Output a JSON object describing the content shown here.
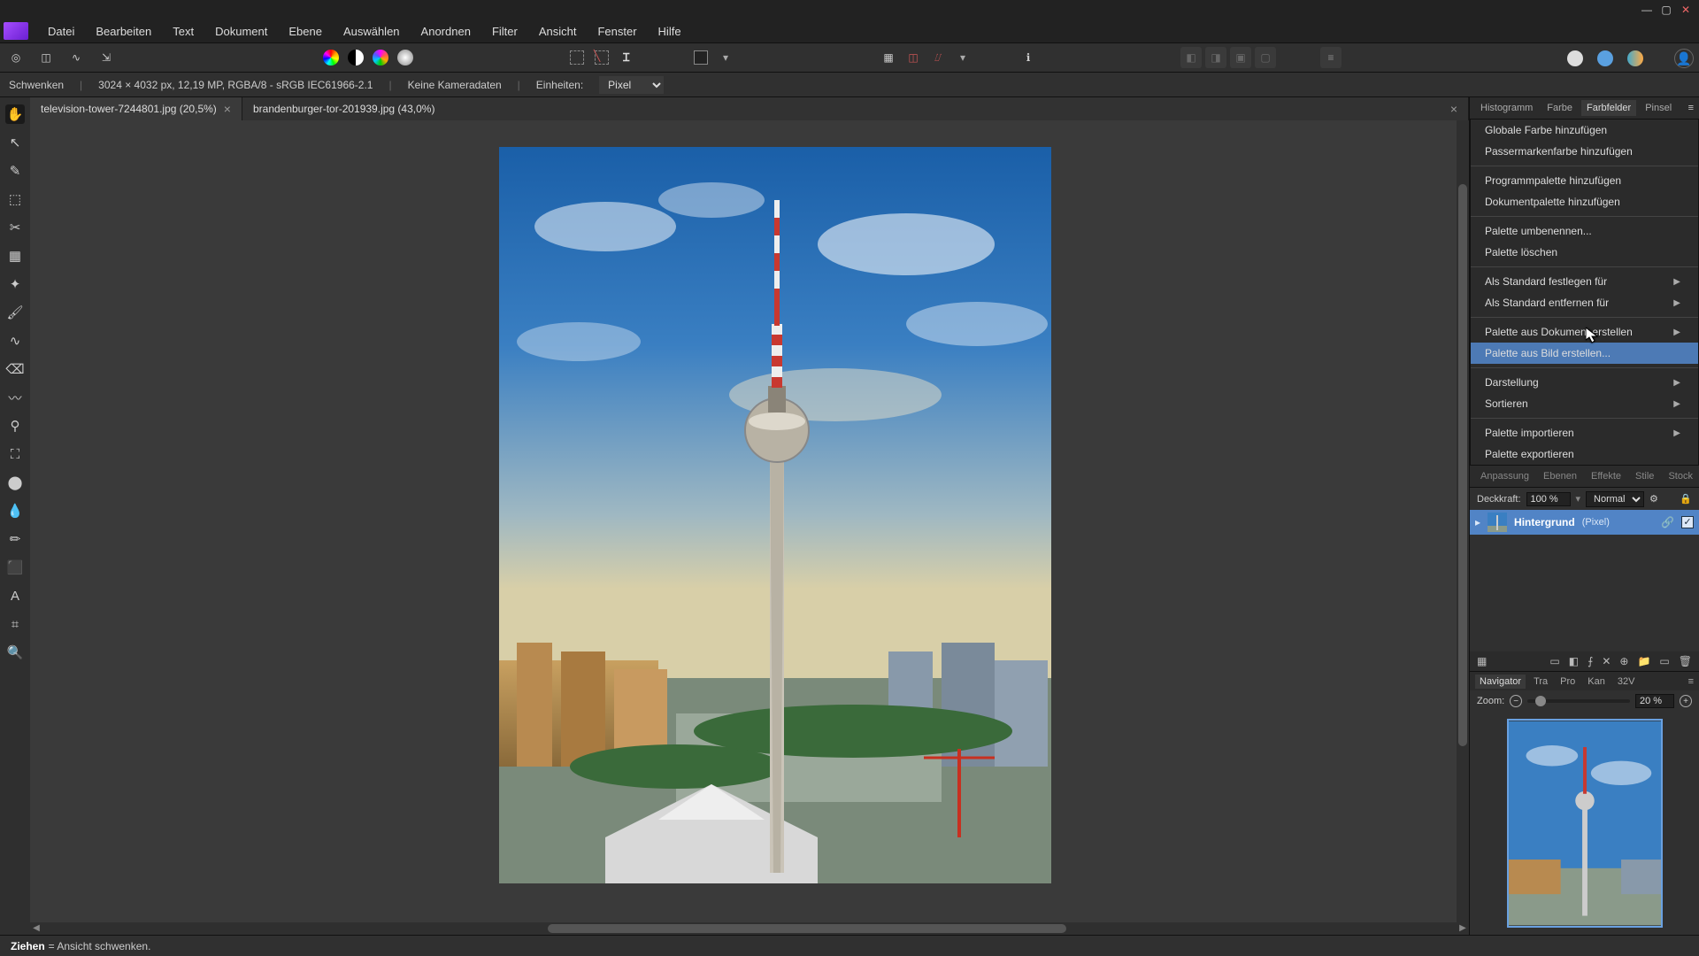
{
  "window": {
    "minimize": "—",
    "maximize": "▢",
    "close": "✕"
  },
  "menubar": [
    "Datei",
    "Bearbeiten",
    "Text",
    "Dokument",
    "Ebene",
    "Auswählen",
    "Anordnen",
    "Filter",
    "Ansicht",
    "Fenster",
    "Hilfe"
  ],
  "contextbar": {
    "tool": "Schwenken",
    "dims": "3024 × 4032 px, 12,19 MP, RGBA/8 - sRGB IEC61966-2.1",
    "camera": "Keine Kameradaten",
    "units_label": "Einheiten:",
    "units_value": "Pixel"
  },
  "tabs": [
    {
      "label": "television-tower-7244801.jpg (20,5%)",
      "active": true
    },
    {
      "label": "brandenburger-tor-201939.jpg (43,0%)",
      "active": false
    }
  ],
  "panel_tabs": {
    "items": [
      "Histogramm",
      "Farbe",
      "Farbfelder",
      "Pinsel"
    ],
    "active": 2
  },
  "context_menu": {
    "groups": [
      [
        "Globale Farbe hinzufügen",
        "Passermarkenfarbe hinzufügen"
      ],
      [
        "Programmpalette hinzufügen",
        "Dokumentpalette hinzufügen"
      ],
      [
        "Palette umbenennen...",
        "Palette löschen"
      ],
      [
        {
          "t": "Als Standard festlegen für",
          "sub": true
        },
        {
          "t": "Als Standard entfernen für",
          "sub": true
        }
      ],
      [
        {
          "t": "Palette aus Dokument erstellen",
          "sub": true
        },
        {
          "t": "Palette aus Bild erstellen...",
          "hover": true
        }
      ],
      [
        {
          "t": "Darstellung",
          "sub": true
        },
        {
          "t": "Sortieren",
          "sub": true
        }
      ],
      [
        {
          "t": "Palette importieren",
          "sub": true
        },
        "Palette exportieren"
      ]
    ]
  },
  "layers_bar_tabs": [
    "Anpassung",
    "Ebenen",
    "Effekte",
    "Stile",
    "Stock"
  ],
  "layers": {
    "opacity_label": "Deckkraft:",
    "opacity_value": "100 %",
    "blend_mode": "Normal",
    "item_name": "Hintergrund",
    "item_type": "(Pixel)"
  },
  "navigator": {
    "tabs": [
      "Navigator",
      "Tra",
      "Pro",
      "Kan",
      "32V"
    ],
    "zoom_label": "Zoom:",
    "zoom_value": "20 %"
  },
  "statusbar": {
    "action": "Ziehen",
    "desc": " = Ansicht schwenken."
  },
  "tool_icons": [
    "✋",
    "↖",
    "✎",
    "⬚",
    "✂",
    "▦",
    "✦",
    "🖌",
    "∿",
    "⌫",
    "〰",
    "⚲",
    "⛶",
    "⬤",
    "💧",
    "✏",
    "⬛",
    "A",
    "⌗",
    "🔍"
  ],
  "bottom_layer_icons": [
    "▦",
    "▭",
    "◧",
    "⨍",
    "✕",
    "⊕",
    "📁",
    "▭",
    "🗑"
  ],
  "colors": {
    "accent": "#5184c6"
  }
}
